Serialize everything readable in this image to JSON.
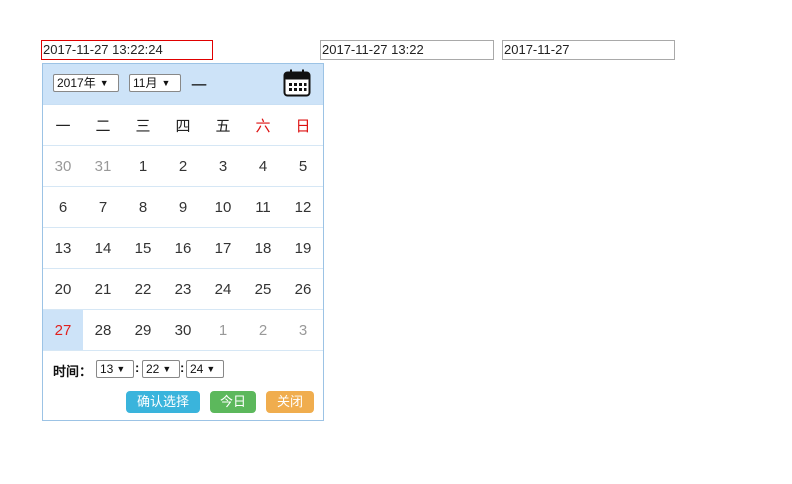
{
  "inputs": {
    "datetime_value": "2017-11-27 13:22:24",
    "datetime_minute_value": "2017-11-27 13:22",
    "date_value": "2017-11-27"
  },
  "calendar": {
    "year_select": "2017年",
    "month_select": "11月",
    "separator": "一",
    "weekdays": [
      "一",
      "二",
      "三",
      "四",
      "五",
      "六",
      "日"
    ],
    "weeks": [
      [
        {
          "d": "30",
          "t": "other"
        },
        {
          "d": "31",
          "t": "other"
        },
        {
          "d": "1",
          "t": ""
        },
        {
          "d": "2",
          "t": ""
        },
        {
          "d": "3",
          "t": ""
        },
        {
          "d": "4",
          "t": ""
        },
        {
          "d": "5",
          "t": ""
        }
      ],
      [
        {
          "d": "6",
          "t": ""
        },
        {
          "d": "7",
          "t": ""
        },
        {
          "d": "8",
          "t": ""
        },
        {
          "d": "9",
          "t": ""
        },
        {
          "d": "10",
          "t": ""
        },
        {
          "d": "11",
          "t": ""
        },
        {
          "d": "12",
          "t": ""
        }
      ],
      [
        {
          "d": "13",
          "t": ""
        },
        {
          "d": "14",
          "t": ""
        },
        {
          "d": "15",
          "t": ""
        },
        {
          "d": "16",
          "t": ""
        },
        {
          "d": "17",
          "t": ""
        },
        {
          "d": "18",
          "t": ""
        },
        {
          "d": "19",
          "t": ""
        }
      ],
      [
        {
          "d": "20",
          "t": ""
        },
        {
          "d": "21",
          "t": ""
        },
        {
          "d": "22",
          "t": ""
        },
        {
          "d": "23",
          "t": ""
        },
        {
          "d": "24",
          "t": ""
        },
        {
          "d": "25",
          "t": ""
        },
        {
          "d": "26",
          "t": ""
        }
      ],
      [
        {
          "d": "27",
          "t": "today"
        },
        {
          "d": "28",
          "t": ""
        },
        {
          "d": "29",
          "t": ""
        },
        {
          "d": "30",
          "t": ""
        },
        {
          "d": "1",
          "t": "other"
        },
        {
          "d": "2",
          "t": "other"
        },
        {
          "d": "3",
          "t": "other"
        }
      ]
    ],
    "time_label": "时间：",
    "hour": "13",
    "minute": "22",
    "second": "24",
    "buttons": {
      "confirm": "确认选择",
      "today": "今日",
      "close": "关闭"
    },
    "colors": {
      "header_bg": "#cde3f8",
      "weekend": "#dd1111",
      "today_bg": "#cde3f8",
      "confirm_btn": "#3ab4dc",
      "today_btn": "#5cb85c",
      "close_btn": "#f0ad4e"
    }
  }
}
